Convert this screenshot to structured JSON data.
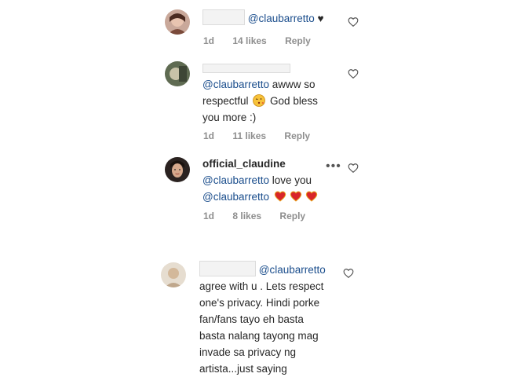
{
  "comments": [
    {
      "mention": "@claubarretto",
      "suffix": " ♥",
      "time": "1d",
      "likes": "14 likes",
      "reply": "Reply"
    },
    {
      "mention": "@claubarretto",
      "text1": " awww so",
      "text2": "respectful",
      "text3": " God bless",
      "text4": "you more :)",
      "time": "1d",
      "likes": "11 likes",
      "reply": "Reply"
    },
    {
      "username": "official_claudine",
      "mention1": "@claubarretto",
      "text1": " love you",
      "mention2": "@claubarretto",
      "time": "1d",
      "likes": "8 likes",
      "reply": "Reply"
    },
    {
      "mention": "@claubarretto",
      "lines": [
        "agree with u . Lets respect",
        "one's privacy. Hindi porke",
        "fan/fans tayo eh basta",
        "basta nalang tayong mag",
        "invade sa privacy ng",
        "artista...just saying"
      ]
    }
  ],
  "icons": {
    "like": "heart-outline-icon",
    "more": "more-options-icon"
  },
  "colors": {
    "mention": "#1a4d8c",
    "meta": "#8e8e8e"
  }
}
